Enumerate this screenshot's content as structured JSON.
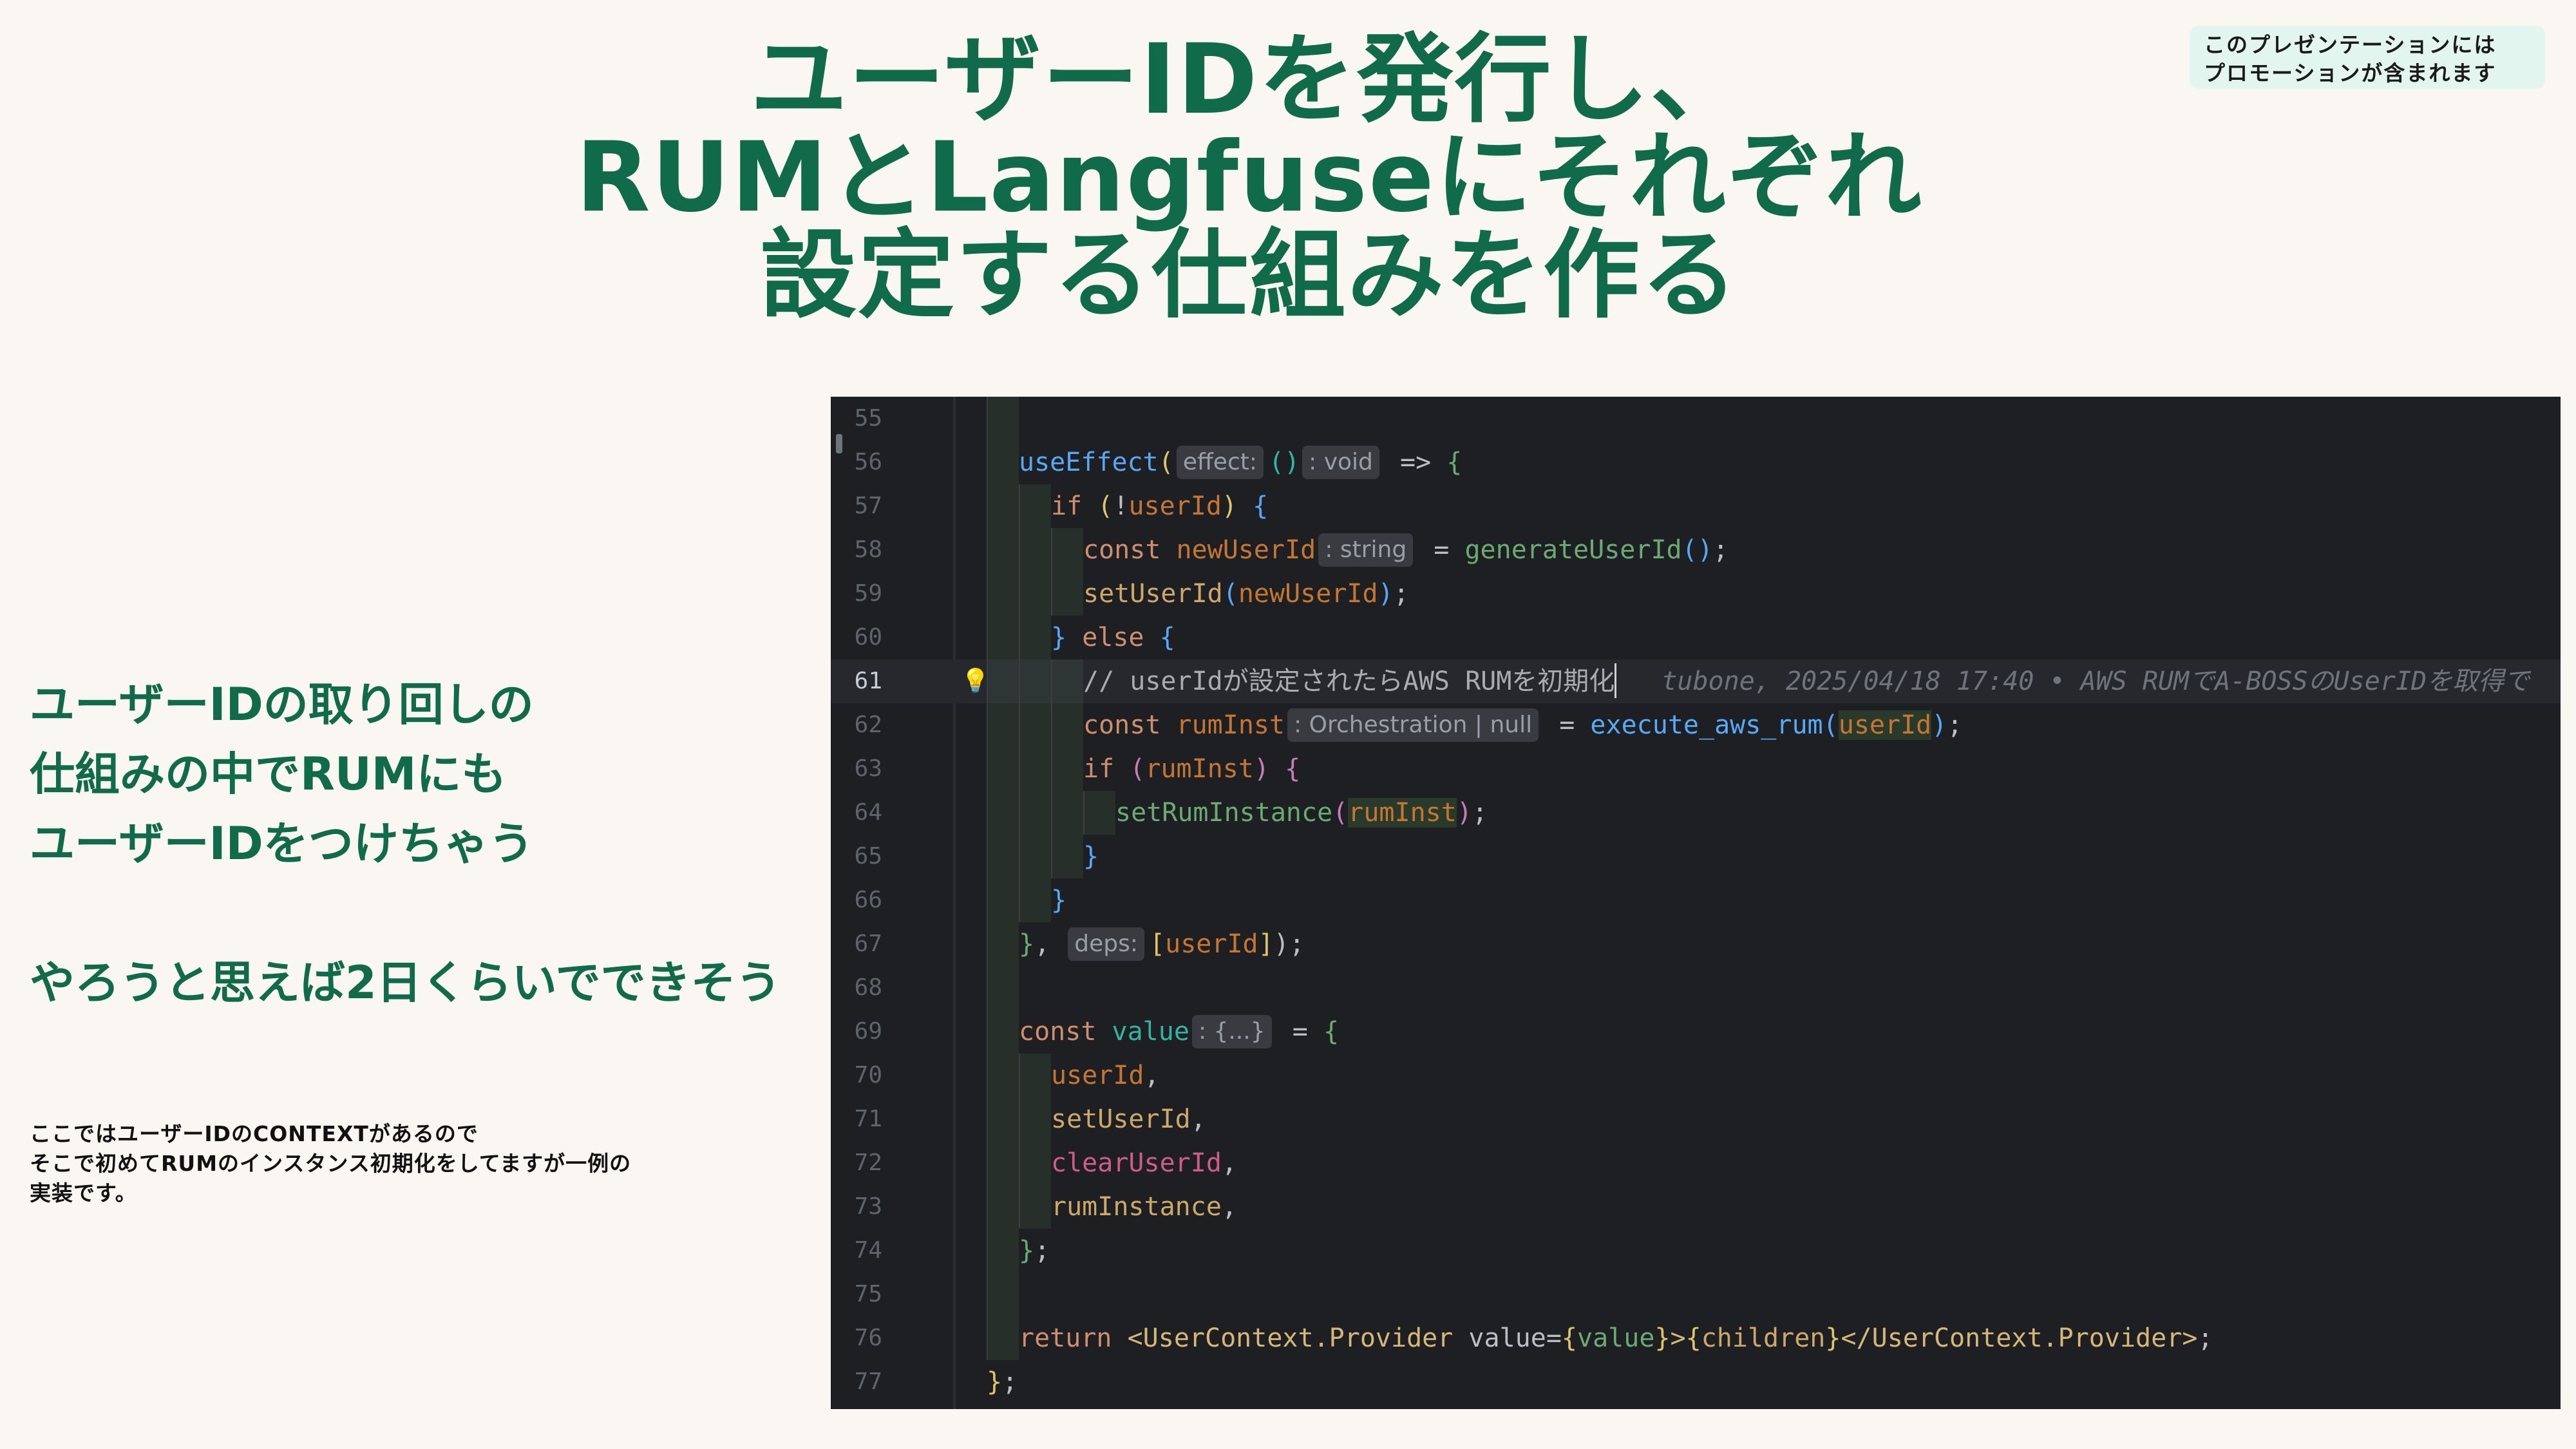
{
  "slide": {
    "title_lines": [
      "ユーザーIDを発行し、",
      "RUMとLangfuseにそれぞれ",
      "設定する仕組みを作る"
    ],
    "promo_lines": [
      "このプレゼンテーションには",
      "プロモーションが含まれます"
    ],
    "left_text": {
      "line1": "ユーザーIDの取り回しの",
      "line2": "仕組みの中でRUMにも",
      "line3": "ユーザーIDをつけちゃう",
      "line4": "やろうと思えば2日くらいでできそう"
    },
    "note_lines": [
      "ここではユーザーIDのCONTEXTがあるので",
      "そこで初めてRUMのインスタンス初期化をしてますが一例の",
      "実装です。"
    ]
  },
  "editor": {
    "line_numbers": [
      "55",
      "56",
      "57",
      "58",
      "59",
      "60",
      "61",
      "62",
      "63",
      "64",
      "65",
      "66",
      "67",
      "68",
      "69",
      "70",
      "71",
      "72",
      "73",
      "74",
      "75",
      "76",
      "77"
    ],
    "active_line": "61",
    "hints": {
      "effect": "effect:",
      "void": ": void",
      "string": ": string",
      "orchestration": ": Orchestration | null",
      "deps": "deps:",
      "obj": ": {...}"
    },
    "comment": "// userIdが設定されたらAWS RUMを初期化",
    "blame": "tubone, 2025/04/18 17:40 • AWS RUMでA-BOSSのUserIDを取得で",
    "tokens": {
      "useEffect": "useEffect",
      "if": "if",
      "const": "const",
      "else": "else",
      "return": "return",
      "userId": "userId",
      "newUserId": "newUserId",
      "generateUserId": "generateUserId",
      "setUserId": "setUserId",
      "rumInst": "rumInst",
      "execute_aws_rum": "execute_aws_rum",
      "setRumInstance": "setRumInstance",
      "value": "value",
      "clearUserId": "clearUserId",
      "rumInstance": "rumInstance",
      "provider_open": "<UserContext.Provider",
      "value_attr": "value=",
      "children": "children",
      "provider_close": "</UserContext.Provider>"
    }
  }
}
